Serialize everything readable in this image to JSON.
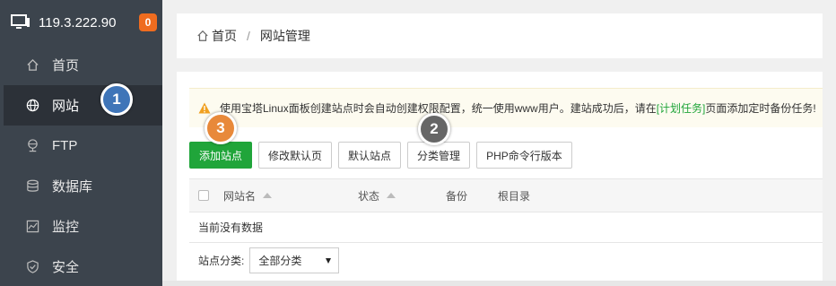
{
  "server": {
    "ip": "119.3.222.90",
    "badge": "0"
  },
  "sidebar": {
    "items": [
      {
        "label": "首页",
        "icon": "home-icon"
      },
      {
        "label": "网站",
        "icon": "globe-icon",
        "active": true
      },
      {
        "label": "FTP",
        "icon": "ftp-icon"
      },
      {
        "label": "数据库",
        "icon": "database-icon"
      },
      {
        "label": "监控",
        "icon": "monitor-chart-icon"
      },
      {
        "label": "安全",
        "icon": "shield-icon"
      }
    ]
  },
  "breadcrumb": {
    "home": "首页",
    "separator": "/",
    "current": "网站管理"
  },
  "alert": {
    "text_before": "使用宝塔Linux面板创建站点时会自动创建权限配置，统一使用www用户。建站成功后，请在",
    "link": "[计划任务]",
    "text_after": "页面添加定时备份任务!"
  },
  "toolbar": {
    "add_site": "添加站点",
    "edit_default_page": "修改默认页",
    "default_site": "默认站点",
    "category_manage": "分类管理",
    "php_cli_version": "PHP命令行版本"
  },
  "table": {
    "columns": [
      "网站名",
      "状态",
      "备份",
      "根目录"
    ],
    "empty_text": "当前没有数据"
  },
  "filter": {
    "label": "站点分类:",
    "selected": "全部分类"
  },
  "markers": [
    "1",
    "2",
    "3"
  ],
  "colors": {
    "accent_green": "#20a53a",
    "sidebar_bg": "#3c444d",
    "badge_orange": "#ef6c1f",
    "marker_blue": "#3f75b8",
    "marker_gray": "#666666",
    "marker_orange": "#e8893a"
  }
}
